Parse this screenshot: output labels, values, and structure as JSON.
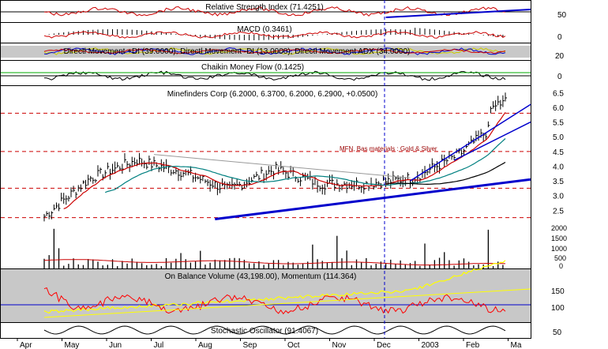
{
  "panels": {
    "rsi": {
      "title": "Relative Strength Index (71.4251)",
      "ticks": [
        "50"
      ]
    },
    "macd": {
      "title": "MACD (0.3461)",
      "ticks": [
        "0"
      ]
    },
    "dmi": {
      "title": "Directl Movement +DI (39.0000), Directl Movement -DI (13.0000), Directl Movement ADX (34.0000)",
      "ticks": [
        "20"
      ]
    },
    "cmf": {
      "title": "Chaikin Money Flow (0.1425)",
      "ticks": [
        "0"
      ]
    },
    "price": {
      "title": "Minefinders Corp (6.2000, 6.3700, 6.2000, 6.2900, +0.0500)",
      "annotation": "MFN, Bas materials : Gold & Silver"
    },
    "volume": {
      "ticks": [
        "2000",
        "1500",
        "1000",
        "500",
        "0"
      ]
    },
    "obv": {
      "title": "On Balance Volume (43,198.00), Momentum (114.364)",
      "ticks": [
        "150",
        "100",
        "50"
      ]
    },
    "stoch": {
      "title": "Stochastic Oscillator (91.4067)"
    }
  },
  "x_axis_labels": [
    "Apr",
    "May",
    "Jun",
    "Jul",
    "Aug",
    "Sep",
    "Oct",
    "Nov",
    "Dec",
    "2003",
    "Feb",
    "Ma"
  ],
  "colors": {
    "price_bars": "#000000",
    "ma_short": "#cc0000",
    "ma_long": "#008080",
    "trendline": "#0000cc",
    "resistance": "#cc0000",
    "obv": "#ffff00",
    "momentum": "#ff0000",
    "panel_bg_gray": "#c8c8c8"
  },
  "chart_data": [
    {
      "type": "line",
      "title": "Minefinders Corp (6.2000, 6.3700, 6.2000, 6.2900, +0.0500)",
      "x": [
        "Apr",
        "May",
        "Jun",
        "Jul",
        "Aug",
        "Sep",
        "Oct",
        "Nov",
        "Dec",
        "2003",
        "Feb"
      ],
      "series": [
        {
          "values": [
            2.3,
            3.6,
            4.2,
            3.8,
            3.2,
            3.9,
            3.4,
            3.4,
            3.6,
            4.4,
            5.7
          ]
        }
      ],
      "last": {
        "open": 6.2,
        "high": 6.37,
        "low": 6.2,
        "close": 6.29,
        "change": 0.05
      },
      "y_ticks": [
        6.5,
        6.0,
        5.5,
        5.0,
        4.5,
        4.0,
        3.5,
        3.0,
        2.5
      ],
      "ylim": [
        2.0,
        6.75
      ],
      "horizontal_lines": [
        5.8,
        4.5,
        3.25,
        2.25
      ],
      "grid": false
    },
    {
      "type": "bar",
      "y_ticks": [
        2000,
        1500,
        1000,
        500,
        0
      ],
      "ylim": [
        0,
        2300
      ]
    },
    {
      "type": "line",
      "title": "On Balance Volume (43,198.00), Momentum (114.364)",
      "y_ticks": [
        150,
        100,
        50
      ],
      "horizontal_lines": [
        106
      ]
    }
  ]
}
